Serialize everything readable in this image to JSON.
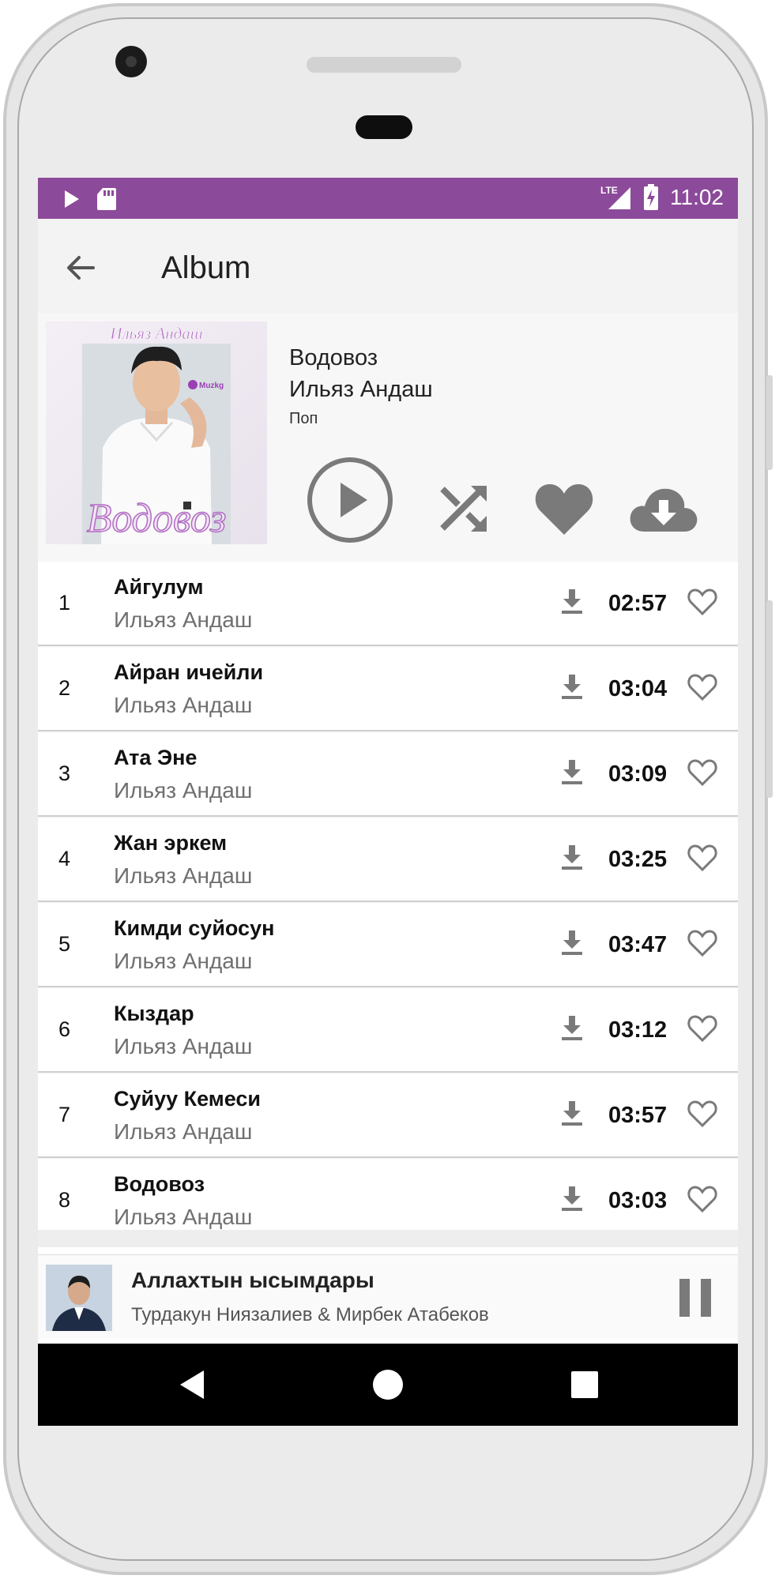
{
  "status_bar": {
    "icons": [
      "play-icon",
      "sd-card-icon",
      "lte-signal-icon",
      "battery-charging-icon"
    ],
    "lte_label": "LTE",
    "time": "11:02"
  },
  "app_bar": {
    "back_icon": "arrow-left-icon",
    "title": "Album"
  },
  "album": {
    "title": "Водовоз",
    "artist": "Ильяз Андаш",
    "genre": "Поп",
    "cover_text_top": "Ильяз Андаш",
    "cover_text_bottom": "Водовоз",
    "cover_logo": "Muzkg",
    "actions": [
      "play-circle-icon",
      "shuffle-icon",
      "heart-filled-icon",
      "cloud-download-icon"
    ]
  },
  "tracks": [
    {
      "num": "1",
      "title": "Айгулум",
      "artist": "Ильяз Андаш",
      "duration": "02:57"
    },
    {
      "num": "2",
      "title": "Айран ичейли",
      "artist": "Ильяз Андаш",
      "duration": "03:04"
    },
    {
      "num": "3",
      "title": "Ата Эне",
      "artist": "Ильяз Андаш",
      "duration": "03:09"
    },
    {
      "num": "4",
      "title": "Жан эркем",
      "artist": "Ильяз Андаш",
      "duration": "03:25"
    },
    {
      "num": "5",
      "title": "Кимди суйосун",
      "artist": "Ильяз Андаш",
      "duration": "03:47"
    },
    {
      "num": "6",
      "title": "Кыздар",
      "artist": "Ильяз Андаш",
      "duration": "03:12"
    },
    {
      "num": "7",
      "title": "Суйуу Кемеси",
      "artist": "Ильяз Андаш",
      "duration": "03:57"
    },
    {
      "num": "8",
      "title": "Водовоз",
      "artist": "Ильяз Андаш",
      "duration": "03:03"
    }
  ],
  "mini_player": {
    "title": "Аллахтын ысымдары",
    "artist": "Турдакун Ниязалиев & Мирбек Атабеков",
    "state_icon": "pause-icon"
  },
  "nav_bar": {
    "icons": [
      "nav-back-icon",
      "nav-home-icon",
      "nav-recents-icon"
    ]
  },
  "colors": {
    "status_bar": "#8c4a9a",
    "icon_gray": "#777777",
    "app_bar": "#f3f3f3"
  }
}
